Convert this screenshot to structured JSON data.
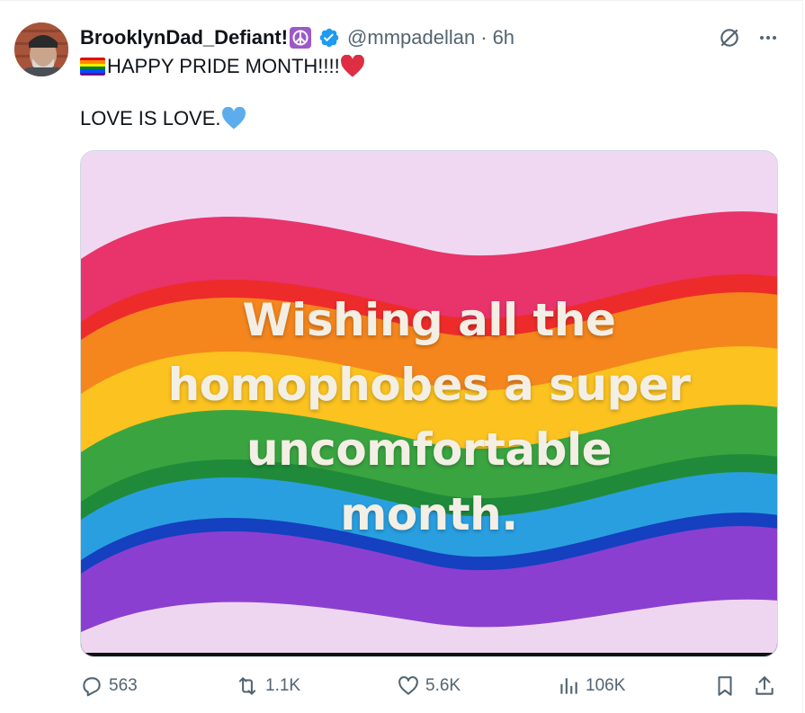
{
  "tweet": {
    "display_name": "BrooklynDad_Defiant!",
    "handle": "@mmpadellan",
    "separator": "·",
    "time": "6h",
    "line1": "HAPPY PRIDE MONTH!!!!",
    "line2": "LOVE IS LOVE.",
    "image_caption": [
      "Wishing all the",
      "homophobes a super",
      "uncomfortable",
      "month."
    ]
  },
  "actions": {
    "replies": "563",
    "reposts": "1.1K",
    "likes": "5.6K",
    "views": "106K"
  },
  "colors": {
    "verified": "#1d9bf0",
    "muted": "#536471",
    "text": "#0f1419",
    "image_bg": "#f0d8f2"
  },
  "icons": [
    "grok-icon",
    "more-icon",
    "reply-icon",
    "repost-icon",
    "like-icon",
    "views-icon",
    "bookmark-icon",
    "share-icon",
    "verified-icon",
    "peace-emoji",
    "heart-emoji",
    "blue-heart-emoji",
    "rainbow-flag-emoji"
  ]
}
